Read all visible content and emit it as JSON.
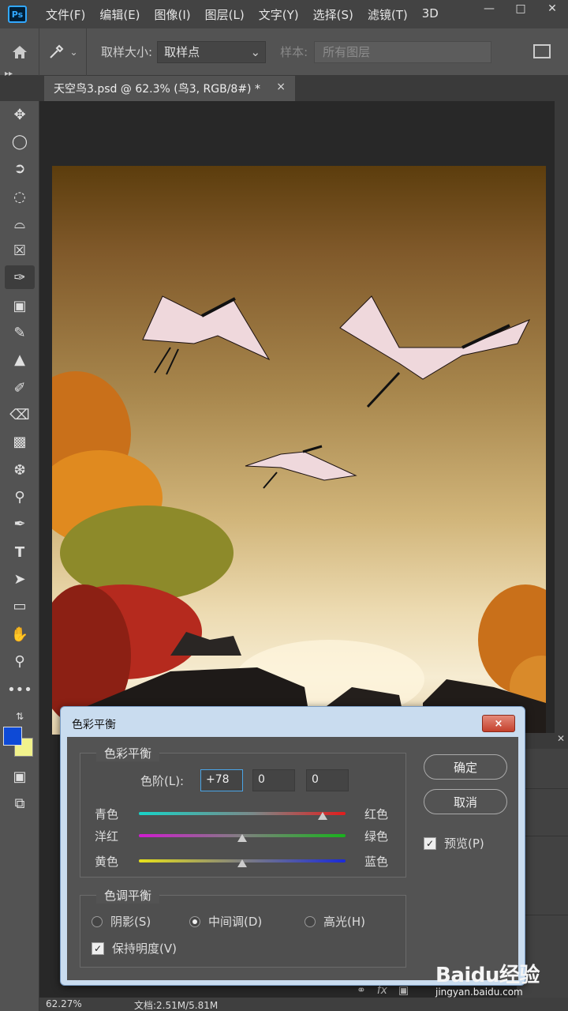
{
  "app": {
    "logo_text": "Ps",
    "menu": [
      "文件(F)",
      "编辑(E)",
      "图像(I)",
      "图层(L)",
      "文字(Y)",
      "选择(S)",
      "滤镜(T)",
      "3D"
    ]
  },
  "options_bar": {
    "sample_size_label": "取样大小:",
    "sample_size_value": "取样点",
    "sample_label": "样本:",
    "sample_value": "所有图层"
  },
  "document": {
    "tab_title": "天空鸟3.psd @ 62.3% (鸟3, RGB/8#) *",
    "close_glyph": "×"
  },
  "status_bar": {
    "zoom": "62.27%",
    "doc_size": "文档:2.51M/5.81M"
  },
  "colors": {
    "foreground": "#0e4ad6",
    "background": "#f1f28c"
  },
  "dialog": {
    "title": "色彩平衡",
    "close_label": "×",
    "color_balance_group": "色彩平衡",
    "levels_label": "色阶(L):",
    "levels": [
      "+78",
      "0",
      "0"
    ],
    "sliders": [
      {
        "left": "青色",
        "right": "红色",
        "value": 78
      },
      {
        "left": "洋红",
        "right": "绿色",
        "value": 0
      },
      {
        "left": "黄色",
        "right": "蓝色",
        "value": 0
      }
    ],
    "tone_balance_group": "色调平衡",
    "tones": [
      {
        "label": "阴影(S)",
        "selected": false
      },
      {
        "label": "中间调(D)",
        "selected": true
      },
      {
        "label": "高光(H)",
        "selected": false
      }
    ],
    "preserve_luminosity": "保持明度(V)",
    "preserve_checked": true,
    "ok_label": "确定",
    "cancel_label": "取消",
    "preview_label": "预览(P)",
    "preview_checked": true
  },
  "watermark": {
    "logo": "Baidu经验",
    "url": "jingyan.baidu.com"
  }
}
